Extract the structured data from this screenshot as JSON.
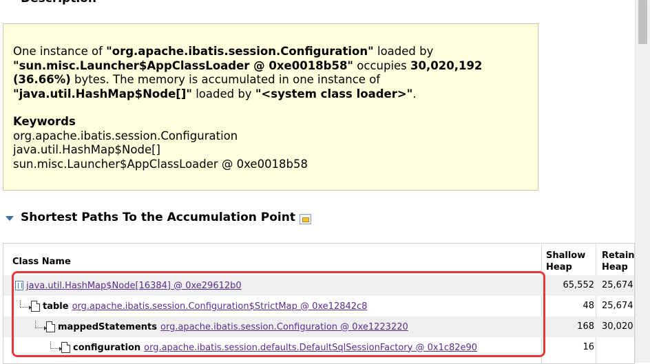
{
  "page": {
    "top_heading": "Description"
  },
  "description": {
    "sentence": [
      {
        "text": "One instance of ",
        "bold": false
      },
      {
        "text": "\"org.apache.ibatis.session.Configuration\"",
        "bold": true
      },
      {
        "text": " loaded by ",
        "bold": false
      },
      {
        "text": "\"sun.misc.Launcher$AppClassLoader @ 0xe0018b58\"",
        "bold": true
      },
      {
        "text": " occupies ",
        "bold": false
      },
      {
        "text": "30,020,192 (36.66%)",
        "bold": true
      },
      {
        "text": " bytes. The memory is accumulated in one instance of ",
        "bold": false
      },
      {
        "text": "\"java.util.HashMap$Node[]\"",
        "bold": true
      },
      {
        "text": " loaded by ",
        "bold": false
      },
      {
        "text": "\"<system class loader>\"",
        "bold": true
      },
      {
        "text": ".",
        "bold": false
      }
    ],
    "keywords_title": "Keywords",
    "keywords": [
      "org.apache.ibatis.session.Configuration",
      "java.util.HashMap$Node[]",
      "sun.misc.Launcher$AppClassLoader @ 0xe0018b58"
    ]
  },
  "section": {
    "title": "Shortest Paths To the Accumulation Point",
    "icon": "navigate-icon"
  },
  "table": {
    "headers": {
      "class_name": "Class Name",
      "shallow_line1": "Shallow",
      "shallow_line2": "Heap",
      "retained_line1": "Retain",
      "retained_line2": "Heap"
    },
    "rows": [
      {
        "field": "",
        "link": "java.util.HashMap$Node[16384] @ 0xe29612b0",
        "shallow": "65,552",
        "retained": "25,674",
        "icon": "array-icon"
      },
      {
        "field": "table",
        "link": "org.apache.ibatis.session.Configuration$StrictMap @ 0xe12842c8",
        "shallow": "48",
        "retained": "25,674",
        "icon": "object-icon"
      },
      {
        "field": "mappedStatements",
        "link": "org.apache.ibatis.session.Configuration @ 0xe1223220",
        "shallow": "168",
        "retained": "30,020",
        "icon": "object-icon"
      },
      {
        "field": "configuration",
        "link": "org.apache.ibatis.session.defaults.DefaultSqlSessionFactory @ 0x1c82e90",
        "shallow": "16",
        "retained": "",
        "icon": "object-icon"
      }
    ]
  },
  "colors": {
    "highlight_border": "#e53935",
    "link": "#5a2d91",
    "box_background": "#ffffdd"
  }
}
